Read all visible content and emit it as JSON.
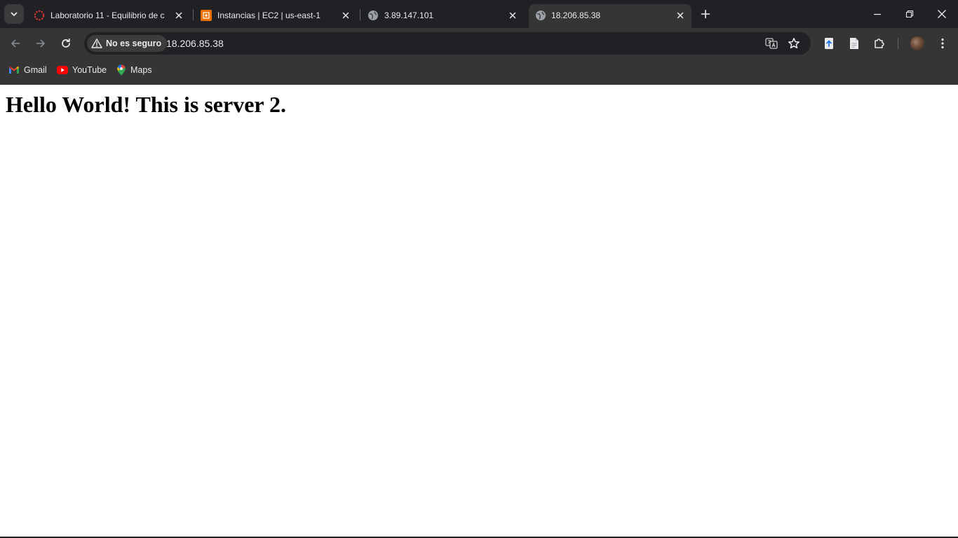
{
  "tabs": [
    {
      "title": "Laboratorio 11 - Equilibrio de c",
      "favicon": "red-dotted-circle-icon",
      "active": false
    },
    {
      "title": "Instancias | EC2 | us-east-1",
      "favicon": "aws-ec2-icon",
      "active": false
    },
    {
      "title": "3.89.147.101",
      "favicon": "globe-icon",
      "active": false
    },
    {
      "title": "18.206.85.38",
      "favicon": "globe-icon",
      "active": true
    }
  ],
  "toolbar": {
    "security_label": "No es seguro",
    "url": "18.206.85.38"
  },
  "bookmarks": [
    {
      "label": "Gmail",
      "icon": "gmail-icon"
    },
    {
      "label": "YouTube",
      "icon": "youtube-icon"
    },
    {
      "label": "Maps",
      "icon": "maps-icon"
    }
  ],
  "page": {
    "heading": "Hello World! This is server 2."
  },
  "colors": {
    "frame": "#202124",
    "toolbar": "#353535",
    "text": "#e8eaed",
    "icon": "#c4c7c5"
  }
}
